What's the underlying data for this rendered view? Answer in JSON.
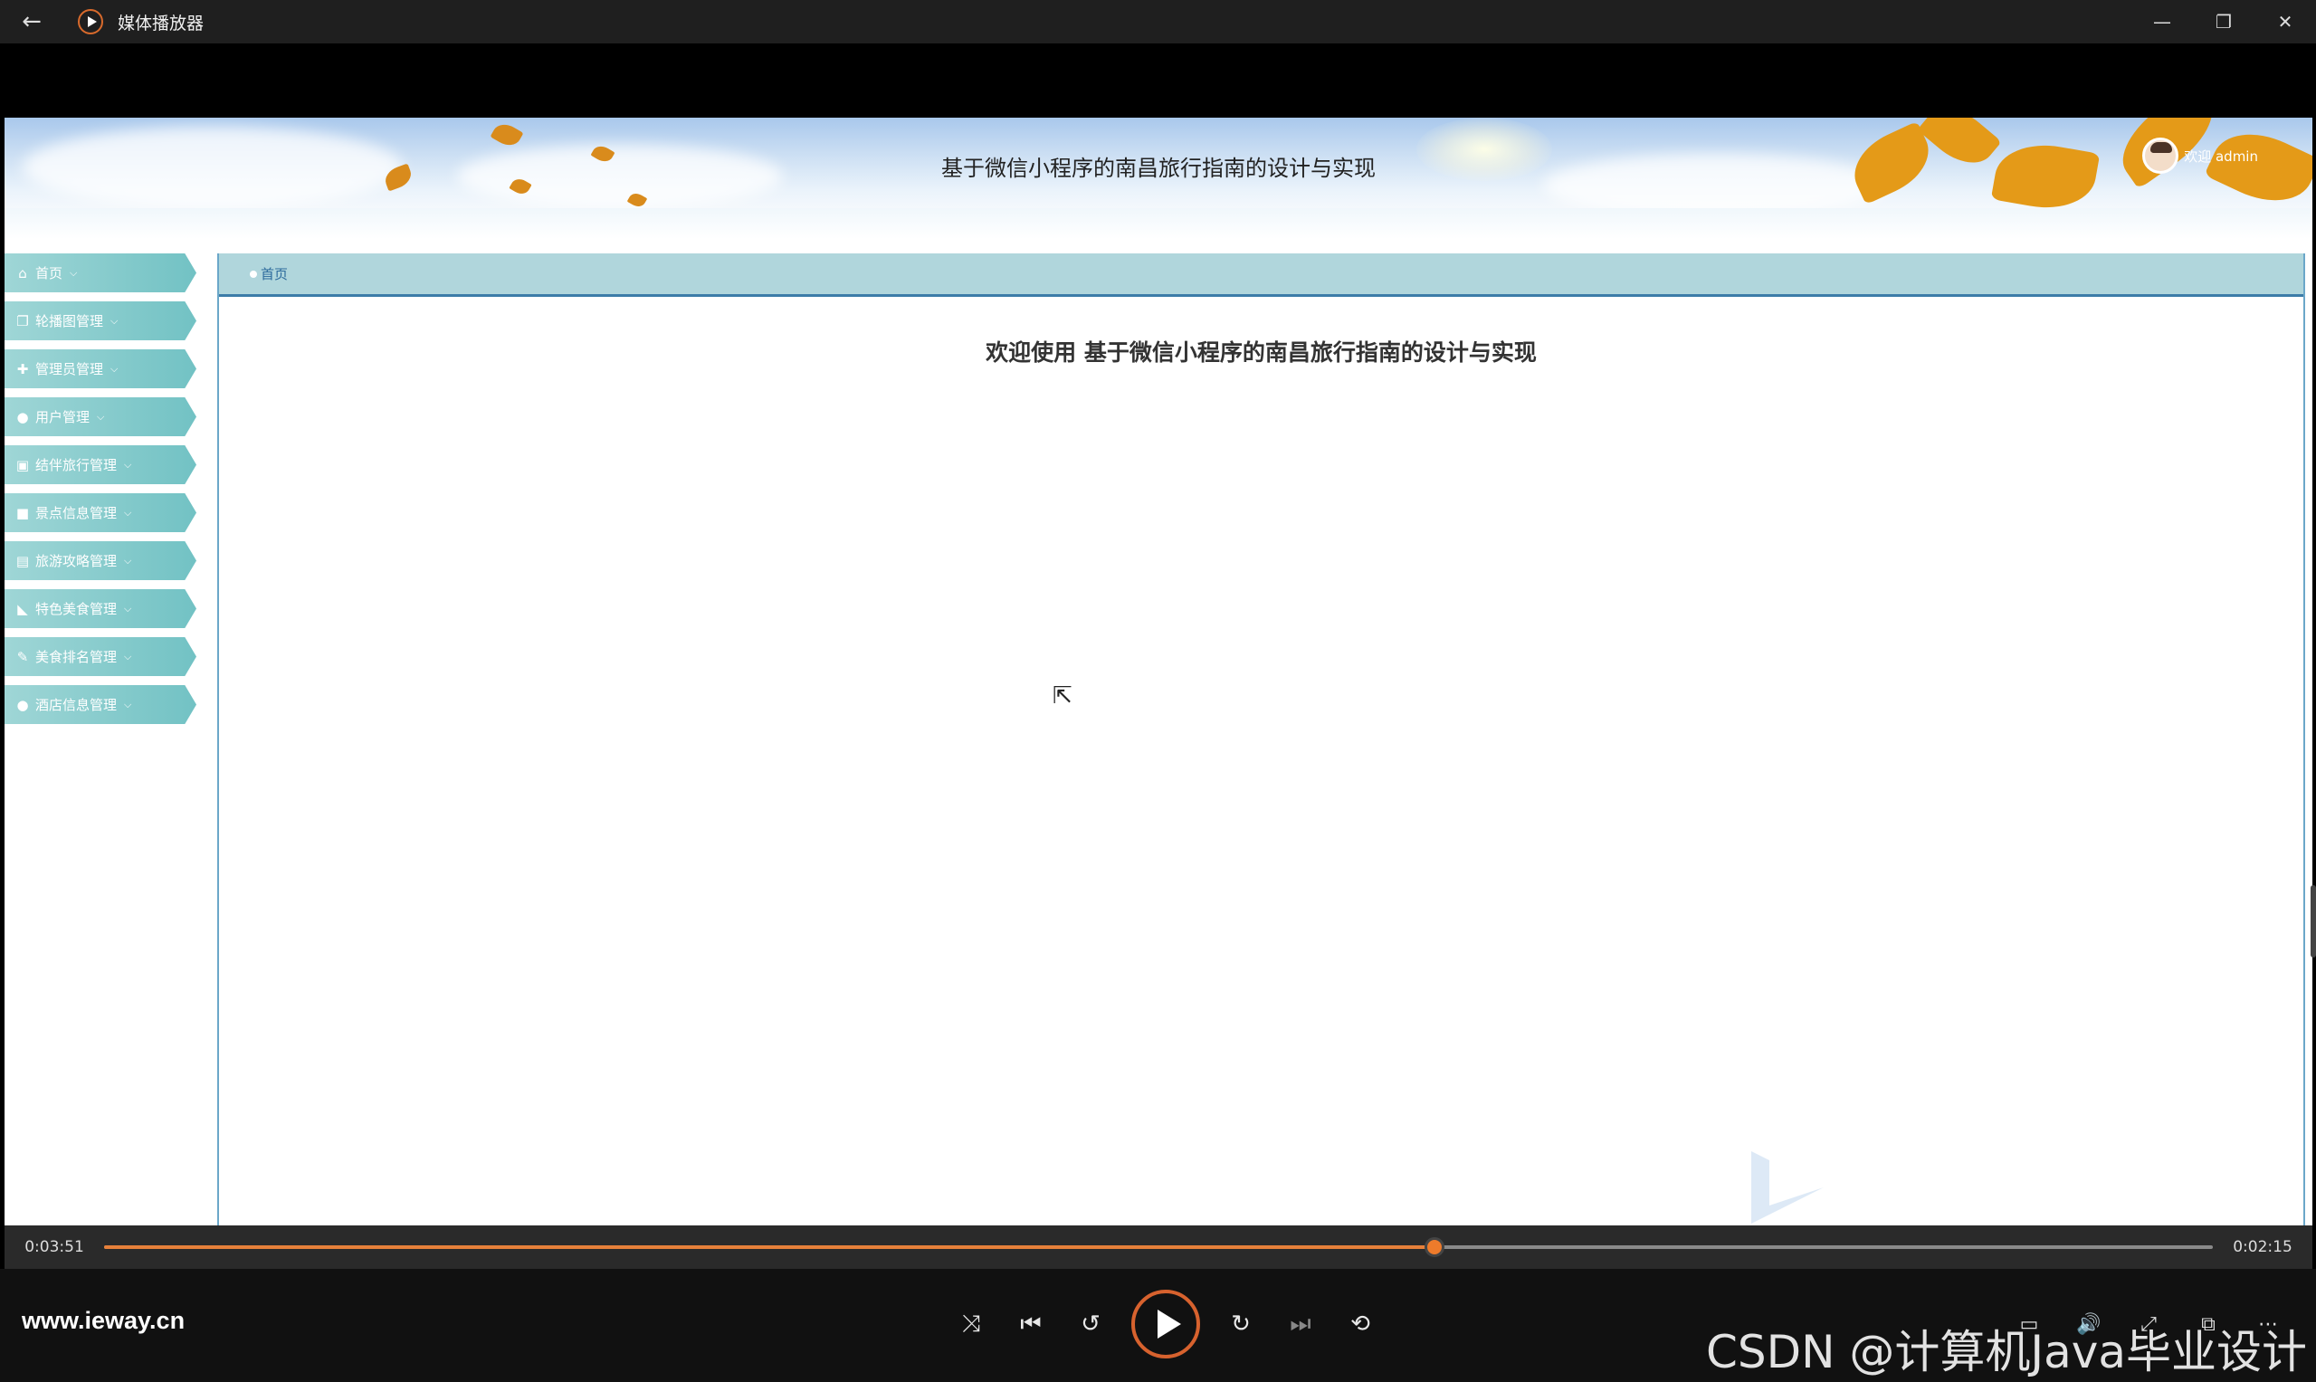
{
  "titlebar": {
    "title": "媒体播放器"
  },
  "header": {
    "site_title": "基于微信小程序的南昌旅行指南的设计与实现",
    "user_greeting": "欢迎 admin"
  },
  "sidebar": {
    "items": [
      {
        "label": "首页",
        "icon": "home-icon",
        "glyph": "⌂"
      },
      {
        "label": "轮播图管理",
        "icon": "images-icon",
        "glyph": "❐"
      },
      {
        "label": "管理员管理",
        "icon": "admin-icon",
        "glyph": "✚"
      },
      {
        "label": "用户管理",
        "icon": "user-icon",
        "glyph": "●"
      },
      {
        "label": "结伴旅行管理",
        "icon": "picture-icon",
        "glyph": "▣"
      },
      {
        "label": "景点信息管理",
        "icon": "briefcase-icon",
        "glyph": "■"
      },
      {
        "label": "旅游攻略管理",
        "icon": "list-icon",
        "glyph": "▤"
      },
      {
        "label": "特色美食管理",
        "icon": "tag-icon",
        "glyph": "◣"
      },
      {
        "label": "美食排名管理",
        "icon": "edit-icon",
        "glyph": "✎"
      },
      {
        "label": "酒店信息管理",
        "icon": "drop-icon",
        "glyph": "●"
      }
    ]
  },
  "main": {
    "breadcrumb": "首页",
    "welcome": "欢迎使用 基于微信小程序的南昌旅行指南的设计与实现"
  },
  "player": {
    "elapsed": "0:03:51",
    "remaining": "0:02:15",
    "progress": 0.631,
    "site_url": "www.ieway.cn",
    "watermark": "CSDN @计算机Java毕业设计"
  },
  "colors": {
    "sidebar_item": "#72c2c4",
    "breadcrumb_bg": "#b0d6dc",
    "accent_orange": "#ee7b2b"
  }
}
